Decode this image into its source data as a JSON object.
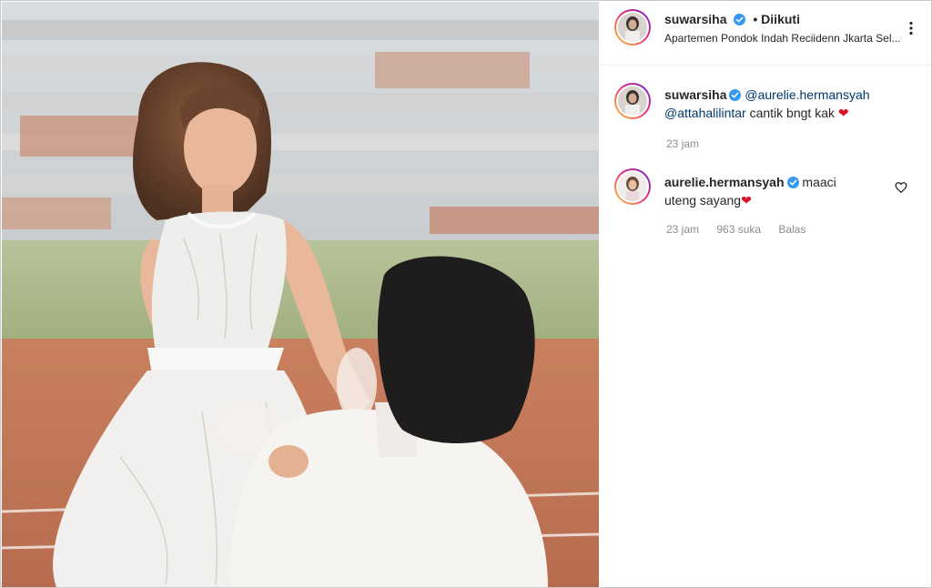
{
  "post": {
    "author": "suwarsiha",
    "follow_state": "• Diikuti",
    "location": "Apartemen Pondok Indah Reciidenn Jkarta Sel..."
  },
  "comments": [
    {
      "username": "suwarsiha",
      "mention1": "@aurelie.hermansyah",
      "mention2": "@attahalilintar",
      "text": " cantik bngt kak",
      "emoji": "❤",
      "time": "23 jam"
    },
    {
      "username": "aurelie.hermansyah",
      "text_line1": "maaci",
      "text_line2": "uteng sayang",
      "emoji": "❤",
      "time": "23 jam",
      "likes": "963 suka",
      "reply": "Balas"
    }
  ],
  "icons": {
    "more": "more-options-icon",
    "verified": "verified-badge-icon",
    "like": "heart-outline-icon"
  },
  "colors": {
    "mention": "#00376b",
    "verified": "#3897f0",
    "heart_emoji": "#d9142b"
  }
}
